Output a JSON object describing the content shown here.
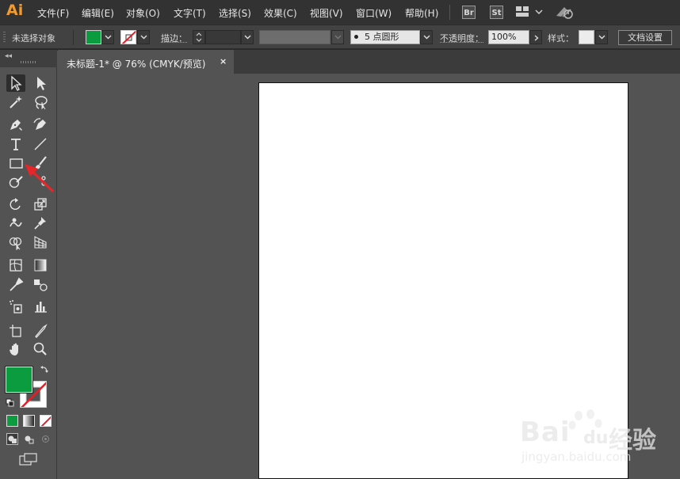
{
  "app": {
    "logo": "Ai"
  },
  "menu": {
    "items": [
      "文件(F)",
      "编辑(E)",
      "对象(O)",
      "文字(T)",
      "选择(S)",
      "效果(C)",
      "视图(V)",
      "窗口(W)",
      "帮助(H)"
    ],
    "bridge_label": "Br",
    "stock_label": "St"
  },
  "control": {
    "selection_status": "未选择对象",
    "stroke_label": "描边：",
    "brush_size": "5",
    "brush_name": "点圆形",
    "opacity_label": "不透明度：",
    "opacity_value": "100%",
    "style_label": "样式：",
    "doc_setup": "文档设置",
    "fill_color": "#0a9c3f"
  },
  "document": {
    "tab_title": "未标题-1* @ 76% (CMYK/预览)",
    "close_glyph": "×"
  },
  "tools": {
    "fill_color": "#0a9c3f",
    "stroke_color": "#ffffff"
  },
  "watermark": {
    "brand_latin": "Bai",
    "brand_du": "du",
    "brand_cn": "经验",
    "url": "jingyan.baidu.com"
  }
}
